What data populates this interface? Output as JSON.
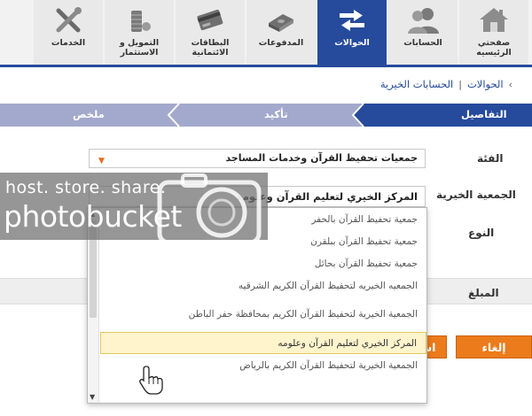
{
  "nav": {
    "items": [
      {
        "label": "صفحتي الرئيسيه",
        "icon": "home-icon",
        "active": false
      },
      {
        "label": "الحسابات",
        "icon": "accounts-users-icon",
        "active": false
      },
      {
        "label": "الحوالات",
        "icon": "transfer-arrows-icon",
        "active": true
      },
      {
        "label": "المدفوعات",
        "icon": "payments-money-icon",
        "active": false
      },
      {
        "label": "البطاقات الائتمانية",
        "icon": "credit-card-icon",
        "active": false
      },
      {
        "label": "التمويل و الاستثمار",
        "icon": "coins-stack-icon",
        "active": false
      },
      {
        "label": "الخدمات",
        "icon": "tools-icon",
        "active": false
      }
    ]
  },
  "breadcrumb": {
    "root": "الحوالات",
    "current": "الحسابات الخيرية"
  },
  "steps": {
    "details": "التفاصيل",
    "confirm": "تأكيد",
    "summary": "ملخص"
  },
  "form": {
    "category_label": "الفئة",
    "category_value": "جمعيات تحفيظ القرآن وخدمات المساجد",
    "association_label": "الجمعية الخيرية",
    "association_value": "المركز الخيري لتعليم القرآن وعلومه",
    "type_label": "النوع",
    "amount_label": "المبلغ"
  },
  "dropdown": {
    "options": [
      "جمعية تحفيظ القرآن بالحفر",
      "جمعية تحفيظ القرآن ببلقرن",
      "جمعية تحفيظ القرآن بحائل",
      "الجمعيه الخيريه لتحفيظ القرآن الكريم الشرقيه",
      "الجمعية الخيرية لتحفيظ القرآن الكريم بمحافظة حفر الباطن",
      "المركز الخيري لتعليم القرآن وعلومه",
      "الجمعية الخيرية لتحفيظ القرآن الكريم بالرياض"
    ],
    "highlighted_index": 5
  },
  "buttons": {
    "continue": "استمرار",
    "cancel": "إلغاء"
  },
  "watermark": {
    "line1": "host. store. share.",
    "line2": "photobucket"
  },
  "colors": {
    "primary_blue": "#264b9c",
    "step_inactive": "#a3a9cc",
    "accent_orange": "#ec7b1b",
    "highlight_yellow": "#fff4cc"
  }
}
